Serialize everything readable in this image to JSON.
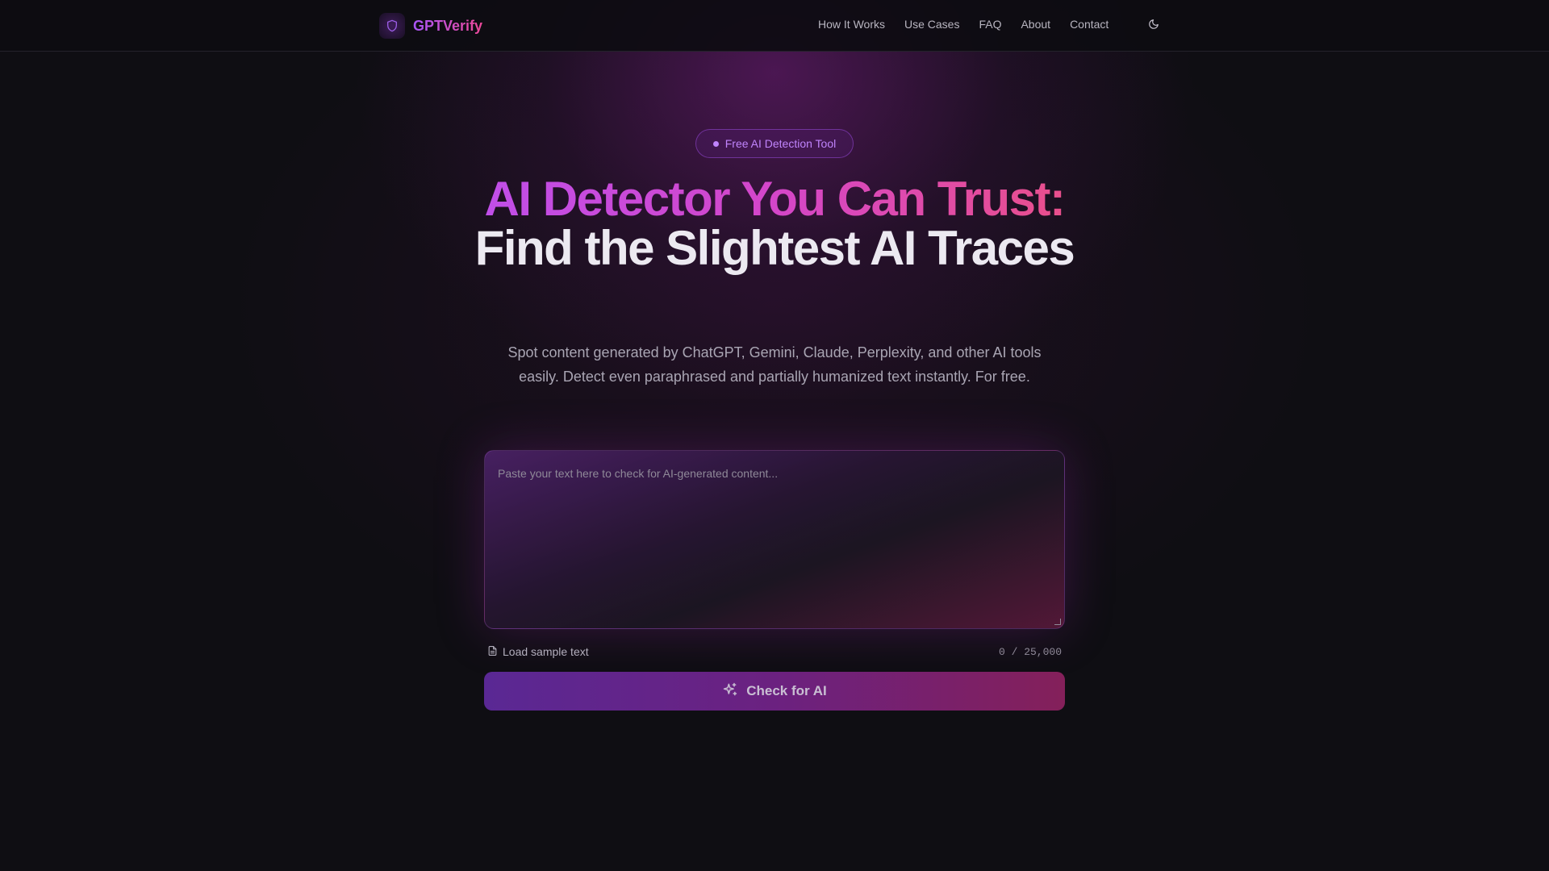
{
  "header": {
    "brand": "GPTVerify",
    "nav": [
      {
        "label": "How It Works"
      },
      {
        "label": "Use Cases"
      },
      {
        "label": "FAQ"
      },
      {
        "label": "About"
      },
      {
        "label": "Contact"
      }
    ],
    "theme_icon": "moon-icon"
  },
  "hero": {
    "badge": "Free AI Detection Tool",
    "headline_gradient": "AI Detector You Can Trust:",
    "headline_plain": "Find the Slightest AI Traces",
    "subtitle": "Spot content generated by ChatGPT, Gemini, Claude, Perplexity, and other AI tools easily. Detect even paraphrased and partially humanized text instantly. For free."
  },
  "checker": {
    "placeholder": "Paste your text here to check for AI-generated content...",
    "value": "",
    "load_sample_label": "Load sample text",
    "counter": "0 / 25,000",
    "check_button_label": "Check for AI"
  },
  "colors": {
    "background": "#0f0e13",
    "brand_purple": "#a855f7",
    "brand_pink": "#ec4899",
    "button_start": "#5a2894",
    "button_end": "#84205a"
  }
}
